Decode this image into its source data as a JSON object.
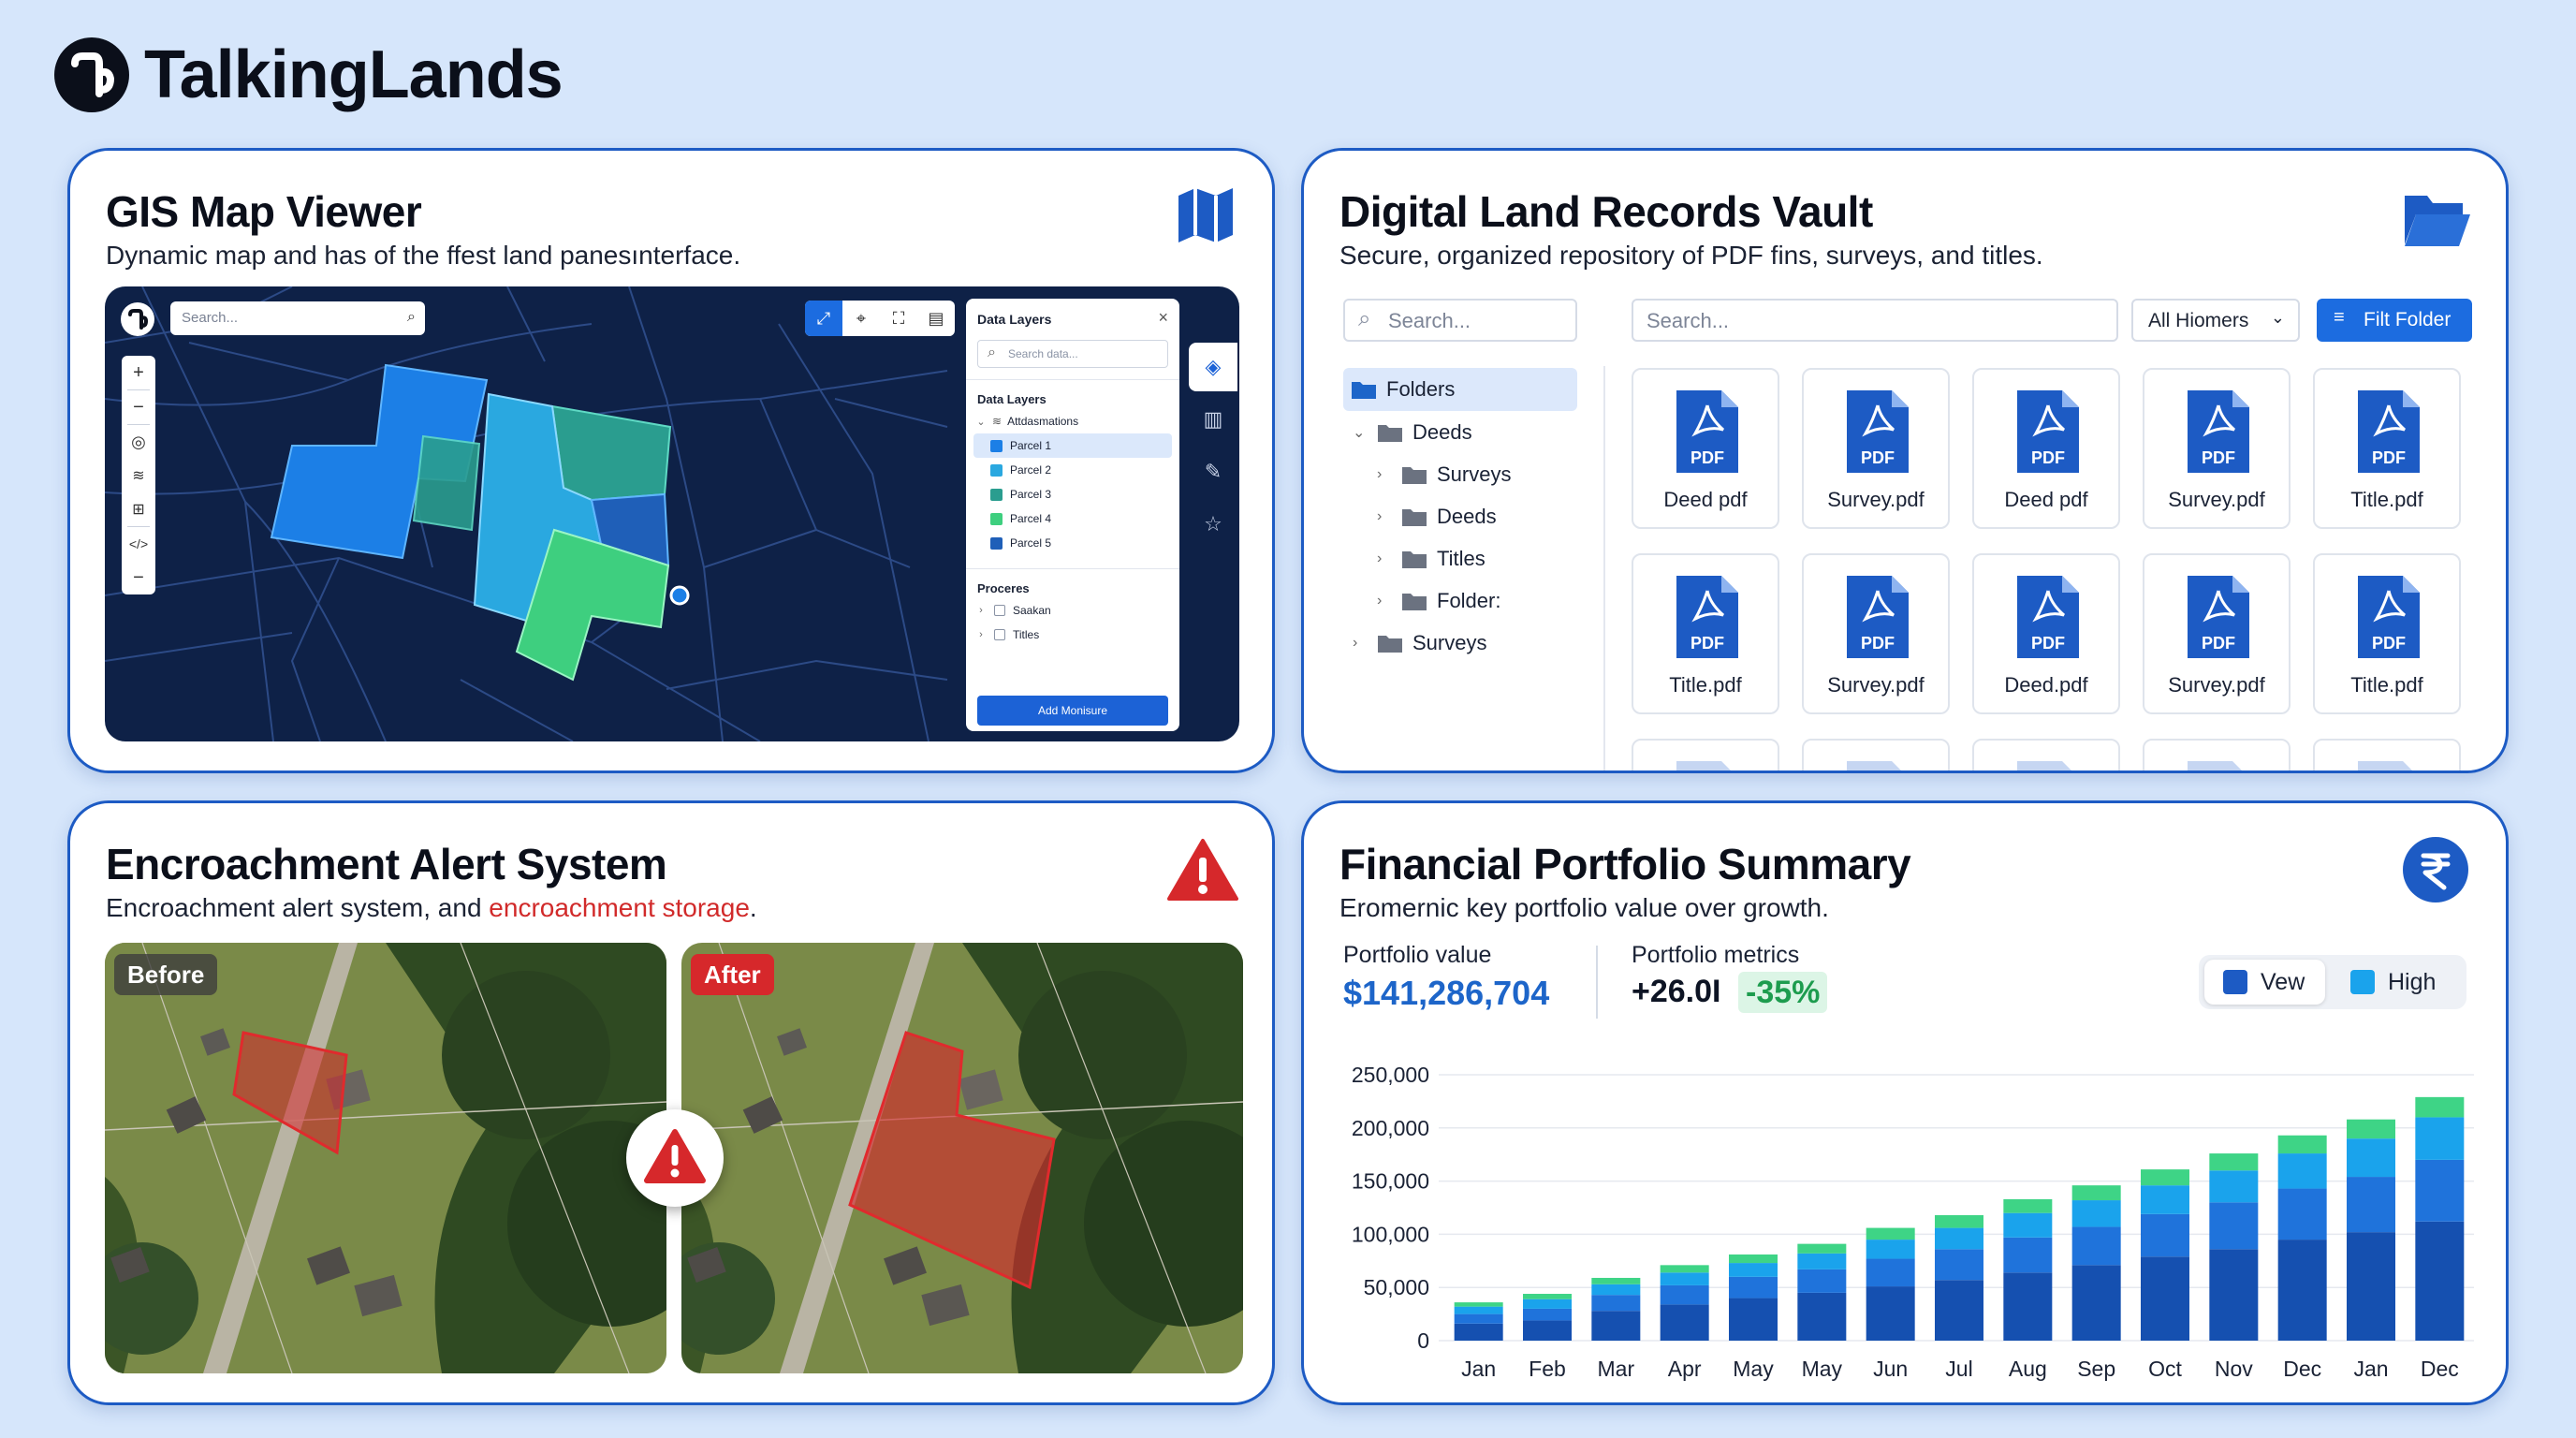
{
  "brand": {
    "name": "TalkingLands"
  },
  "gis": {
    "title": "GIS Map Viewer",
    "subtitle": "Dynamic map and has of the ffest land panesınterface.",
    "icon": "map-icon",
    "search_placeholder": "Search...",
    "layers_panel": {
      "title": "Data Layers",
      "search_placeholder": "Search data...",
      "section_layers": "Data Layers",
      "group": "Attdasmations",
      "parcels": [
        {
          "label": "Parcel 1",
          "color": "#1c7fe6",
          "selected": true
        },
        {
          "label": "Parcel 2",
          "color": "#2aa8e0"
        },
        {
          "label": "Parcel 3",
          "color": "#2a9d8f"
        },
        {
          "label": "Parcel 4",
          "color": "#3ecf7f"
        },
        {
          "label": "Parcel 5",
          "color": "#1f5fb8"
        }
      ],
      "section_process": "Proceres",
      "process_items": [
        "Saakan",
        "Titles"
      ],
      "add_button": "Add Monisure"
    }
  },
  "vault": {
    "title": "Digital Land Records Vault",
    "subtitle": "Secure, organized repository of PDF fins, surveys, and titles.",
    "icon": "folder-open-icon",
    "left_search_placeholder": "Search...",
    "right_search_placeholder": "Search...",
    "dropdown_value": "All Hiomers",
    "filter_button": "Filt Folder",
    "tree": [
      "Folders",
      "Deeds",
      "Surveys",
      "Deeds",
      "Titles",
      "Folder:",
      "Surveys"
    ],
    "files": [
      "Deed pdf",
      "Survey.pdf",
      "Deed pdf",
      "Survey.pdf",
      "Title.pdf",
      "Title.pdf",
      "Survey.pdf",
      "Deed.pdf",
      "Survey.pdf",
      "Title.pdf"
    ],
    "pdf_badge": "PDF"
  },
  "alert": {
    "title": "Encroachment Alert System",
    "subtitle_pre": "Encroachment alert system, and ",
    "subtitle_red": "encroachment storage",
    "subtitle_post": ".",
    "before_label": "Before",
    "after_label": "After",
    "accent": "#d6282b"
  },
  "finance": {
    "title": "Financial Portfolio Summary",
    "subtitle": "Eromernic key portfolio value over growth.",
    "icon": "rupee-icon",
    "portfolio_value_label": "Portfolio value",
    "portfolio_value": "$141,286,704",
    "metrics_label": "Portfolio metrics",
    "metrics_value": "+26.0I",
    "metrics_delta": "-35%",
    "legend": [
      {
        "label": "Vew",
        "color": "#1d5bc4"
      },
      {
        "label": "High",
        "color": "#1aa3ec"
      }
    ]
  },
  "chart_data": {
    "type": "bar",
    "stacked": true,
    "categories": [
      "Jan",
      "Feb",
      "Mar",
      "Apr",
      "May",
      "May",
      "Jun",
      "Jul",
      "Aug",
      "Sep",
      "Oct",
      "Nov",
      "Dec",
      "Jan",
      "Dec"
    ],
    "series": [
      {
        "name": "Vew",
        "color": "#1550b0",
        "values": [
          16000,
          19000,
          28000,
          34000,
          40000,
          45000,
          51000,
          57000,
          64000,
          71000,
          79000,
          86000,
          95000,
          102000,
          112000
        ]
      },
      {
        "color": "#1f73db",
        "values": [
          9000,
          11000,
          15000,
          18000,
          20000,
          22000,
          26000,
          29000,
          33000,
          36000,
          40000,
          44000,
          48000,
          52000,
          58000
        ]
      },
      {
        "name": "High",
        "color": "#1aa3ec",
        "values": [
          7000,
          9000,
          10000,
          12000,
          13000,
          15000,
          18000,
          20000,
          23000,
          25000,
          27000,
          30000,
          33000,
          36000,
          40000
        ]
      },
      {
        "color": "#3ed486",
        "values": [
          4000,
          5000,
          6000,
          7000,
          8000,
          9000,
          11000,
          12000,
          13000,
          14000,
          15000,
          16000,
          17000,
          18000,
          19000
        ]
      }
    ],
    "yticks": [
      "250,000",
      "200,000",
      "150,000",
      "100,000",
      "50,000",
      "0"
    ],
    "ylim": [
      0,
      250000
    ]
  }
}
